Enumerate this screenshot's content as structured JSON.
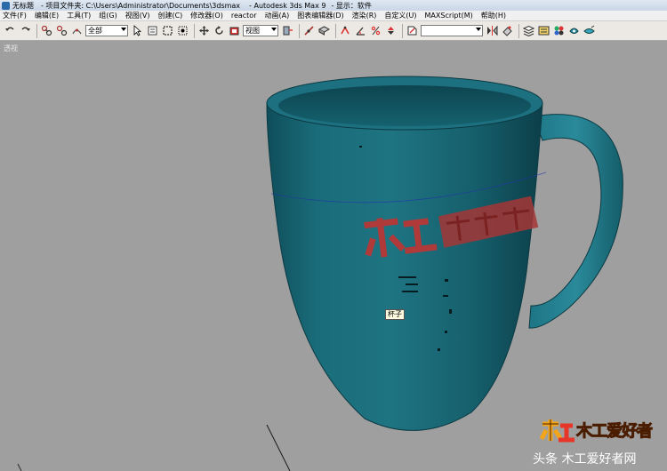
{
  "window": {
    "title_parts": [
      "无标题",
      "- 项目文件夹: C:\\Users\\Administrator\\Documents\\3dsmax",
      "- Autodesk 3ds Max 9",
      "- 显示：软件"
    ]
  },
  "menu": {
    "items": [
      "文件(F)",
      "编辑(E)",
      "工具(T)",
      "组(G)",
      "视图(V)",
      "创建(C)",
      "修改器(O)",
      "reactor",
      "动画(A)",
      "图表编辑器(D)",
      "渲染(R)",
      "自定义(U)",
      "MAXScript(M)",
      "帮助(H)"
    ]
  },
  "toolbar": {
    "selection_filter": "全部",
    "reference_coord": "视图",
    "named_selection": ""
  },
  "viewport": {
    "label": "透视",
    "object_label": "杯子"
  },
  "logo_text": "木工爱好者",
  "watermark": {
    "caption": "头条 木工爱好者网"
  },
  "colors": {
    "viewport_bg": "#9f9f9f",
    "mug": "#1d6a78",
    "logo_red": "#b03a3a"
  }
}
